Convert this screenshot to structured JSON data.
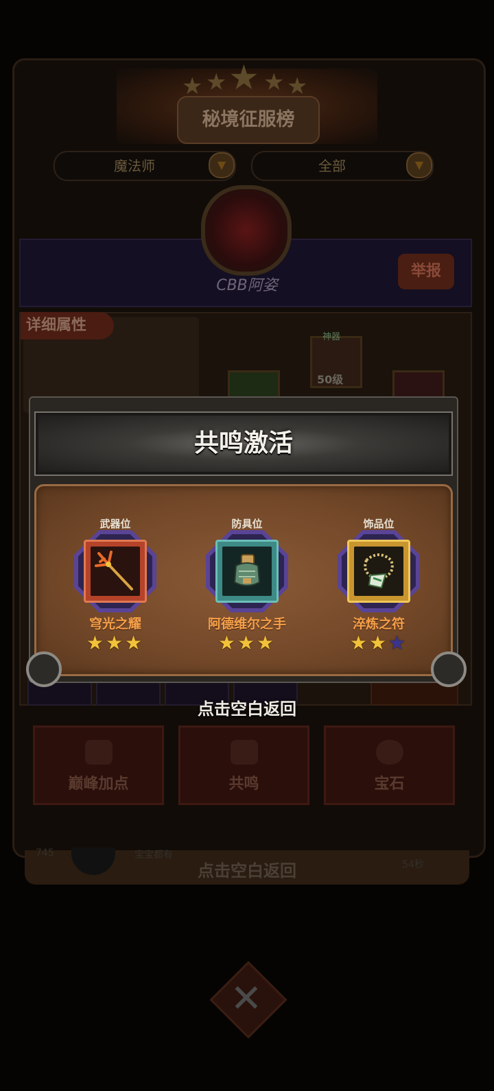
{
  "background": {
    "leaderboard_title": "秘境征服榜",
    "filter_class": "魔法师",
    "filter_scope": "全部",
    "player_name": "CBB阿姿",
    "report_button": "举报",
    "detail_attributes_tab": "详细属性",
    "god_label": "神器",
    "equip_level": "50级",
    "bottom_buttons": [
      "巅峰加点",
      "共鸣",
      "宝石"
    ],
    "bottom_return_text": "点击空白返回",
    "bottom_row_name": "宝宝都有",
    "bottom_row_rank": "745",
    "bottom_row_time": "54秒"
  },
  "modal": {
    "title": "共鸣激活",
    "items": [
      {
        "slot": "武器位",
        "name": "穹光之耀",
        "stars": 3,
        "max_stars": 3,
        "icon": "trident-icon",
        "frame_color": "#b5432a",
        "name_color": "#f6a04a"
      },
      {
        "slot": "防具位",
        "name": "阿德维尔之手",
        "stars": 3,
        "max_stars": 3,
        "icon": "gauntlet-icon",
        "frame_color": "#3d8a86",
        "name_color": "#f6a04a"
      },
      {
        "slot": "饰品位",
        "name": "淬炼之符",
        "stars": 2,
        "max_stars": 3,
        "icon": "amulet-icon",
        "frame_color": "#c9952e",
        "name_color": "#f6a04a"
      }
    ]
  },
  "return_hint": "点击空白返回"
}
